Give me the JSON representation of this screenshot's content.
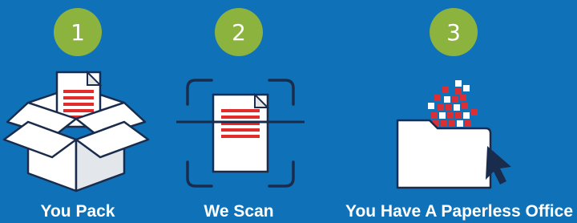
{
  "colors": {
    "background": "#0f72b8",
    "badge": "#8db33f",
    "line": "#e22b2b",
    "navy": "#1a2c4d",
    "pixel_red": "#d92f35",
    "paper": "#ffffff"
  },
  "steps": [
    {
      "number": "1",
      "label": "You Pack",
      "icon": "open-box-with-document-icon"
    },
    {
      "number": "2",
      "label": "We Scan",
      "icon": "document-scan-icon"
    },
    {
      "number": "3",
      "label": "You Have A Paperless Office",
      "icon": "digital-folder-cursor-icon"
    }
  ]
}
